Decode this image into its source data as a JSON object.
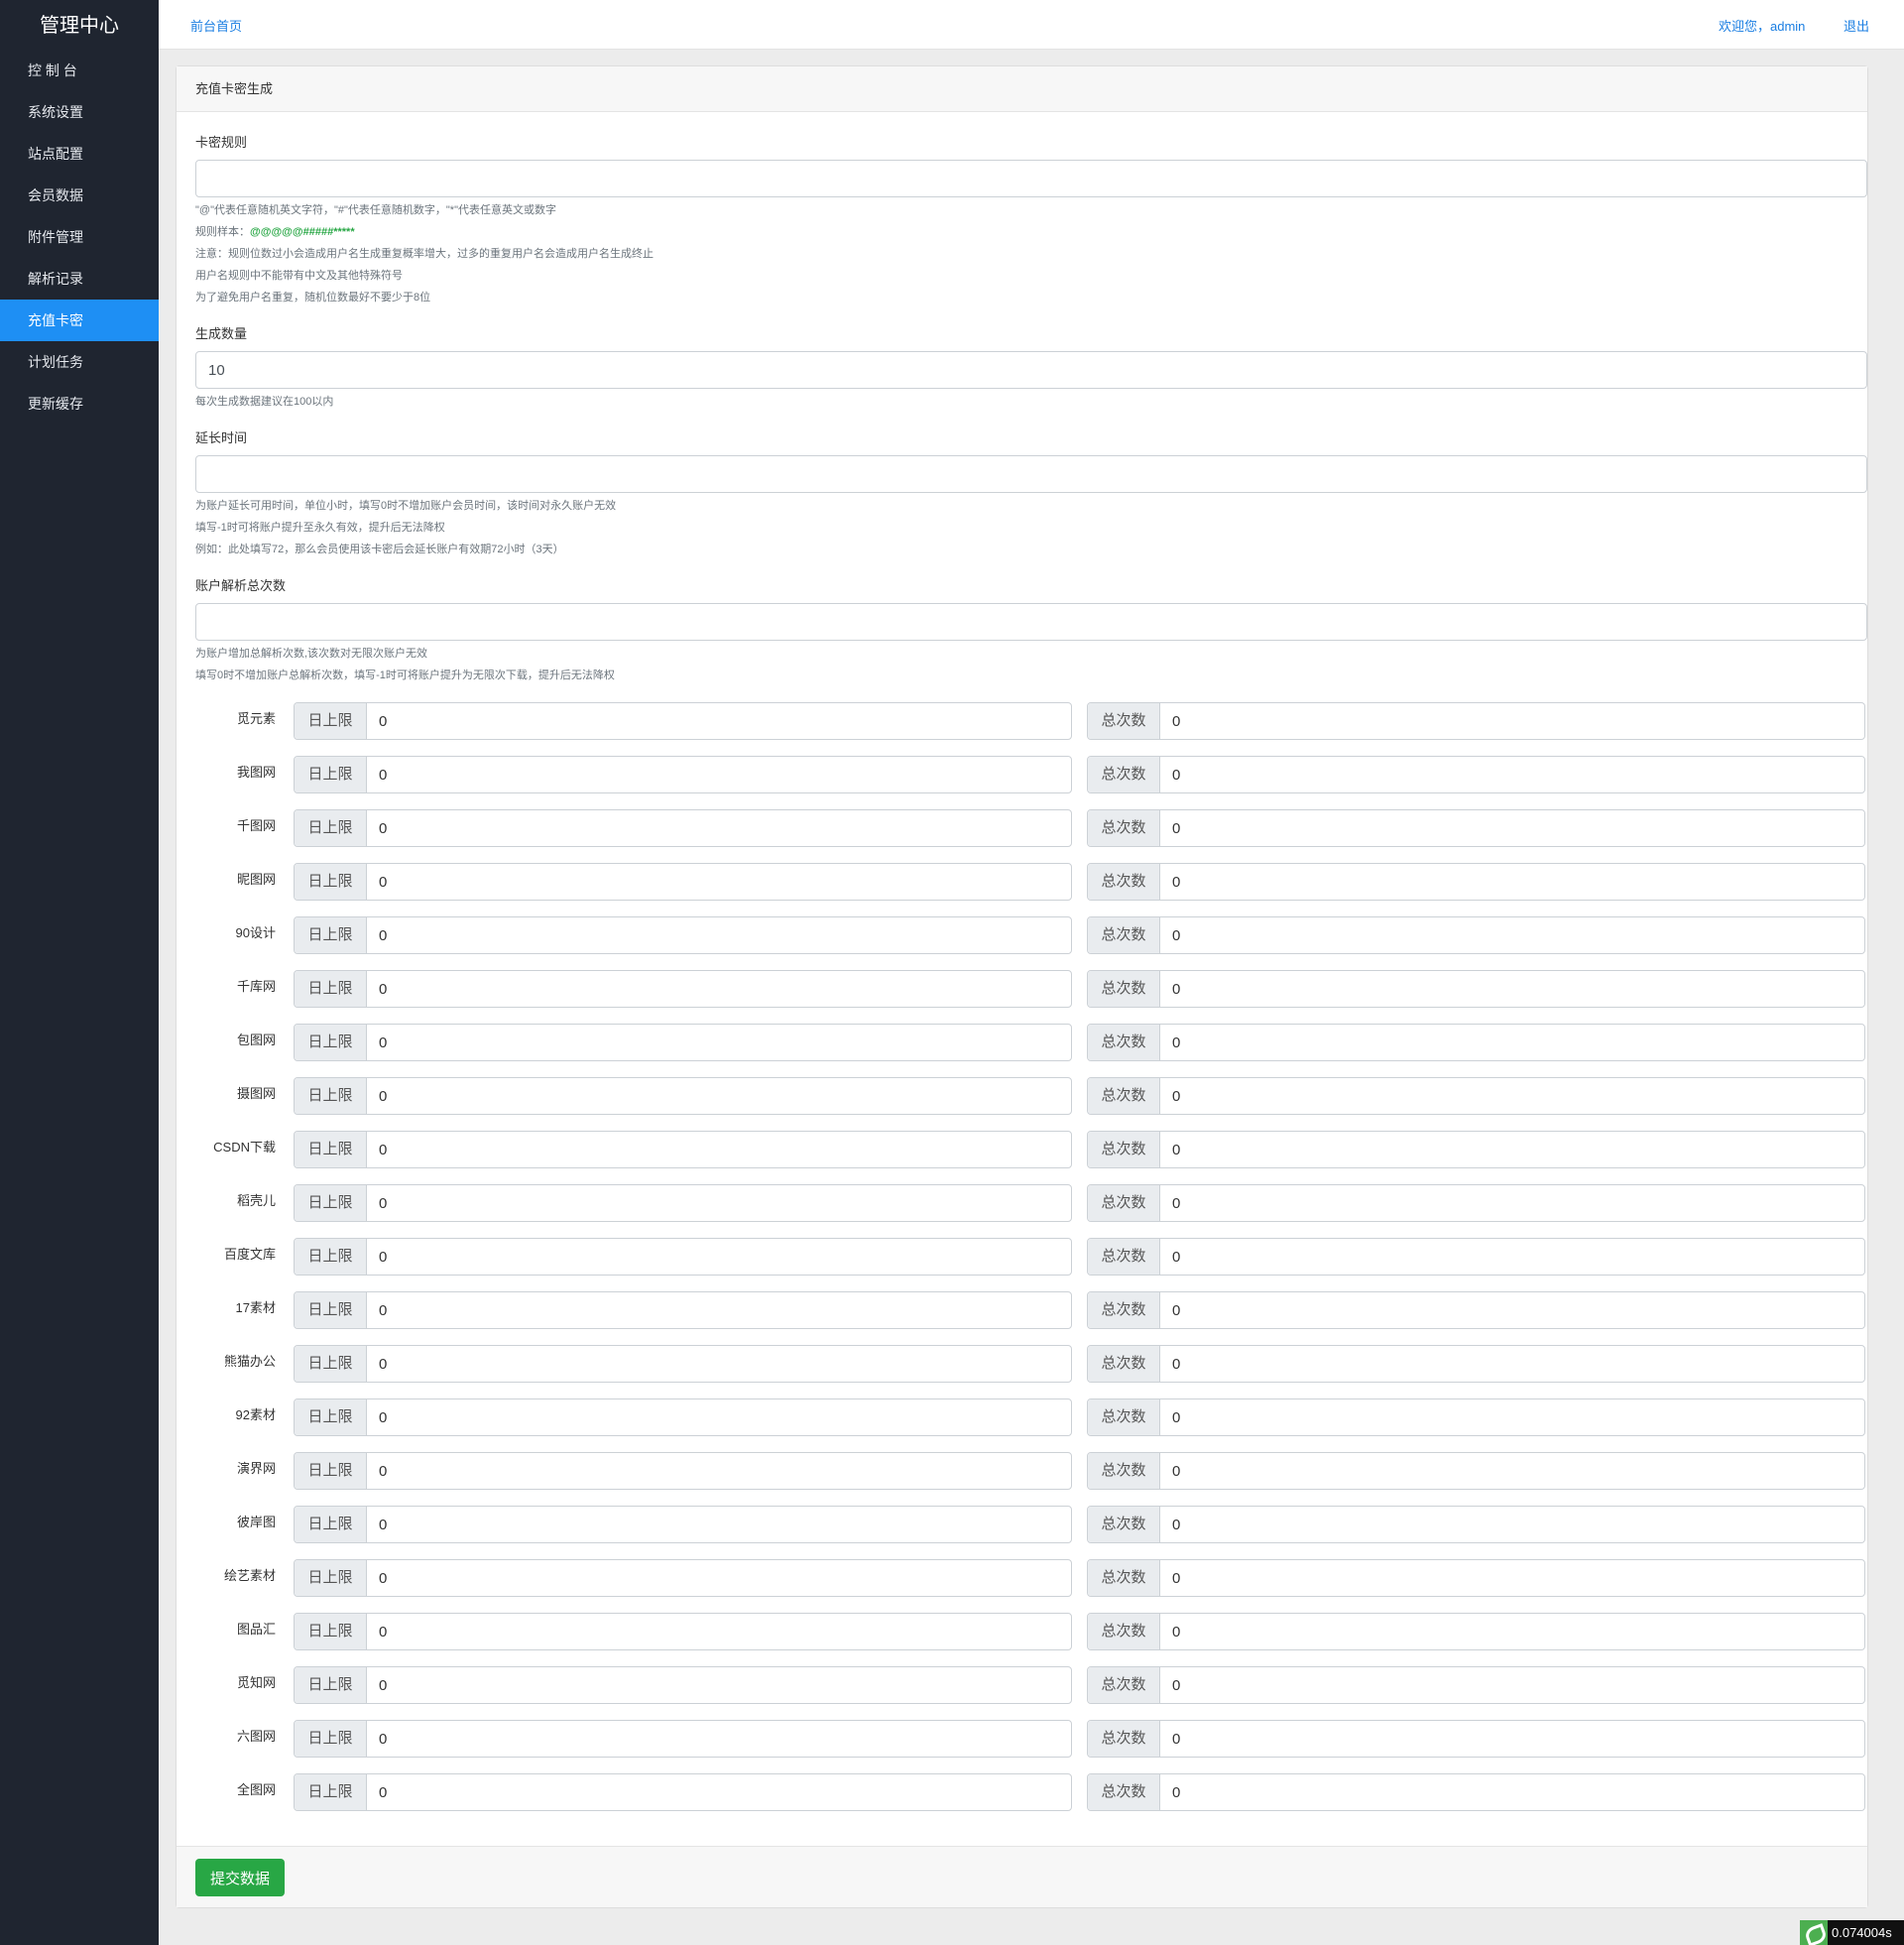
{
  "sidebar": {
    "brand": "管理中心",
    "items": [
      {
        "label": "控 制 台",
        "active": false
      },
      {
        "label": "系统设置",
        "active": false
      },
      {
        "label": "站点配置",
        "active": false
      },
      {
        "label": "会员数据",
        "active": false
      },
      {
        "label": "附件管理",
        "active": false
      },
      {
        "label": "解析记录",
        "active": false
      },
      {
        "label": "充值卡密",
        "active": true
      },
      {
        "label": "计划任务",
        "active": false
      },
      {
        "label": "更新缓存",
        "active": false
      }
    ]
  },
  "topbar": {
    "home": "前台首页",
    "welcome": "欢迎您，admin",
    "logout": "退出"
  },
  "card": {
    "title": "充值卡密生成",
    "rule": {
      "label": "卡密规则",
      "value": "",
      "hint1": "\"@\"代表任意随机英文字符，\"#\"代表任意随机数字，\"*\"代表任意英文或数字",
      "hint2_prefix": "规则样本：",
      "hint2_sample": "@@@@@#####*****",
      "hint3": "注意：规则位数过小会造成用户名生成重复概率增大，过多的重复用户名会造成用户名生成终止",
      "hint4": "用户名规则中不能带有中文及其他特殊符号",
      "hint5": "为了避免用户名重复，随机位数最好不要少于8位"
    },
    "quantity": {
      "label": "生成数量",
      "value": "10",
      "hint": "每次生成数据建议在100以内"
    },
    "extend": {
      "label": "延长时间",
      "value": "",
      "hint1": "为账户延长可用时间，单位小时，填写0时不增加账户会员时间，该时间对永久账户无效",
      "hint2": "填写-1时可将账户提升至永久有效，提升后无法降权",
      "hint3": "例如：此处填写72，那么会员使用该卡密后会延长账户有效期72小时（3天）"
    },
    "parse_total": {
      "label": "账户解析总次数",
      "value": "",
      "hint1": "为账户增加总解析次数,该次数对无限次账户无效",
      "hint2": "填写0时不增加账户总解析次数，填写-1时可将账户提升为无限次下载，提升后无法降权"
    },
    "daily_addon": "日上限",
    "total_addon": "总次数",
    "sites": [
      {
        "name": "觅元素",
        "daily": "0",
        "total": "0"
      },
      {
        "name": "我图网",
        "daily": "0",
        "total": "0"
      },
      {
        "name": "千图网",
        "daily": "0",
        "total": "0"
      },
      {
        "name": "昵图网",
        "daily": "0",
        "total": "0"
      },
      {
        "name": "90设计",
        "daily": "0",
        "total": "0"
      },
      {
        "name": "千库网",
        "daily": "0",
        "total": "0"
      },
      {
        "name": "包图网",
        "daily": "0",
        "total": "0"
      },
      {
        "name": "摄图网",
        "daily": "0",
        "total": "0"
      },
      {
        "name": "CSDN下载",
        "daily": "0",
        "total": "0"
      },
      {
        "name": "稻壳儿",
        "daily": "0",
        "total": "0"
      },
      {
        "name": "百度文库",
        "daily": "0",
        "total": "0"
      },
      {
        "name": "17素材",
        "daily": "0",
        "total": "0"
      },
      {
        "name": "熊猫办公",
        "daily": "0",
        "total": "0"
      },
      {
        "name": "92素材",
        "daily": "0",
        "total": "0"
      },
      {
        "name": "演界网",
        "daily": "0",
        "total": "0"
      },
      {
        "name": "彼岸图",
        "daily": "0",
        "total": "0"
      },
      {
        "name": "绘艺素材",
        "daily": "0",
        "total": "0"
      },
      {
        "name": "图品汇",
        "daily": "0",
        "total": "0"
      },
      {
        "name": "觅知网",
        "daily": "0",
        "total": "0"
      },
      {
        "name": "六图网",
        "daily": "0",
        "total": "0"
      },
      {
        "name": "全图网",
        "daily": "0",
        "total": "0"
      }
    ],
    "submit": "提交数据"
  },
  "timer": "0.074004s",
  "colors": {
    "sidebar": "#1f2530",
    "active": "#1e8ff4",
    "link": "#1a7ee2",
    "submit": "#28a745"
  }
}
